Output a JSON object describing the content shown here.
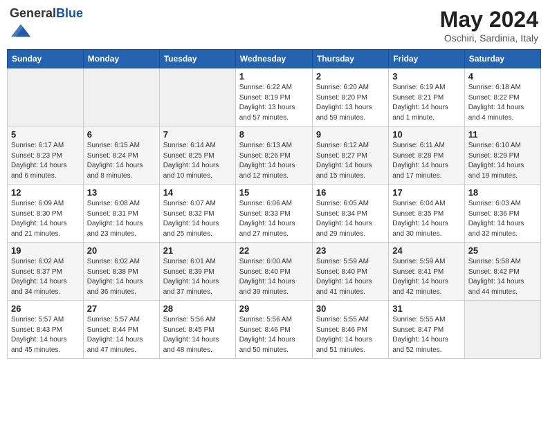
{
  "header": {
    "logo_general": "General",
    "logo_blue": "Blue",
    "month_title": "May 2024",
    "subtitle": "Oschiri, Sardinia, Italy"
  },
  "days_of_week": [
    "Sunday",
    "Monday",
    "Tuesday",
    "Wednesday",
    "Thursday",
    "Friday",
    "Saturday"
  ],
  "weeks": [
    [
      {
        "num": "",
        "info": ""
      },
      {
        "num": "",
        "info": ""
      },
      {
        "num": "",
        "info": ""
      },
      {
        "num": "1",
        "info": "Sunrise: 6:22 AM\nSunset: 8:19 PM\nDaylight: 13 hours\nand 57 minutes."
      },
      {
        "num": "2",
        "info": "Sunrise: 6:20 AM\nSunset: 8:20 PM\nDaylight: 13 hours\nand 59 minutes."
      },
      {
        "num": "3",
        "info": "Sunrise: 6:19 AM\nSunset: 8:21 PM\nDaylight: 14 hours\nand 1 minute."
      },
      {
        "num": "4",
        "info": "Sunrise: 6:18 AM\nSunset: 8:22 PM\nDaylight: 14 hours\nand 4 minutes."
      }
    ],
    [
      {
        "num": "5",
        "info": "Sunrise: 6:17 AM\nSunset: 8:23 PM\nDaylight: 14 hours\nand 6 minutes."
      },
      {
        "num": "6",
        "info": "Sunrise: 6:15 AM\nSunset: 8:24 PM\nDaylight: 14 hours\nand 8 minutes."
      },
      {
        "num": "7",
        "info": "Sunrise: 6:14 AM\nSunset: 8:25 PM\nDaylight: 14 hours\nand 10 minutes."
      },
      {
        "num": "8",
        "info": "Sunrise: 6:13 AM\nSunset: 8:26 PM\nDaylight: 14 hours\nand 12 minutes."
      },
      {
        "num": "9",
        "info": "Sunrise: 6:12 AM\nSunset: 8:27 PM\nDaylight: 14 hours\nand 15 minutes."
      },
      {
        "num": "10",
        "info": "Sunrise: 6:11 AM\nSunset: 8:28 PM\nDaylight: 14 hours\nand 17 minutes."
      },
      {
        "num": "11",
        "info": "Sunrise: 6:10 AM\nSunset: 8:29 PM\nDaylight: 14 hours\nand 19 minutes."
      }
    ],
    [
      {
        "num": "12",
        "info": "Sunrise: 6:09 AM\nSunset: 8:30 PM\nDaylight: 14 hours\nand 21 minutes."
      },
      {
        "num": "13",
        "info": "Sunrise: 6:08 AM\nSunset: 8:31 PM\nDaylight: 14 hours\nand 23 minutes."
      },
      {
        "num": "14",
        "info": "Sunrise: 6:07 AM\nSunset: 8:32 PM\nDaylight: 14 hours\nand 25 minutes."
      },
      {
        "num": "15",
        "info": "Sunrise: 6:06 AM\nSunset: 8:33 PM\nDaylight: 14 hours\nand 27 minutes."
      },
      {
        "num": "16",
        "info": "Sunrise: 6:05 AM\nSunset: 8:34 PM\nDaylight: 14 hours\nand 29 minutes."
      },
      {
        "num": "17",
        "info": "Sunrise: 6:04 AM\nSunset: 8:35 PM\nDaylight: 14 hours\nand 30 minutes."
      },
      {
        "num": "18",
        "info": "Sunrise: 6:03 AM\nSunset: 8:36 PM\nDaylight: 14 hours\nand 32 minutes."
      }
    ],
    [
      {
        "num": "19",
        "info": "Sunrise: 6:02 AM\nSunset: 8:37 PM\nDaylight: 14 hours\nand 34 minutes."
      },
      {
        "num": "20",
        "info": "Sunrise: 6:02 AM\nSunset: 8:38 PM\nDaylight: 14 hours\nand 36 minutes."
      },
      {
        "num": "21",
        "info": "Sunrise: 6:01 AM\nSunset: 8:39 PM\nDaylight: 14 hours\nand 37 minutes."
      },
      {
        "num": "22",
        "info": "Sunrise: 6:00 AM\nSunset: 8:40 PM\nDaylight: 14 hours\nand 39 minutes."
      },
      {
        "num": "23",
        "info": "Sunrise: 5:59 AM\nSunset: 8:40 PM\nDaylight: 14 hours\nand 41 minutes."
      },
      {
        "num": "24",
        "info": "Sunrise: 5:59 AM\nSunset: 8:41 PM\nDaylight: 14 hours\nand 42 minutes."
      },
      {
        "num": "25",
        "info": "Sunrise: 5:58 AM\nSunset: 8:42 PM\nDaylight: 14 hours\nand 44 minutes."
      }
    ],
    [
      {
        "num": "26",
        "info": "Sunrise: 5:57 AM\nSunset: 8:43 PM\nDaylight: 14 hours\nand 45 minutes."
      },
      {
        "num": "27",
        "info": "Sunrise: 5:57 AM\nSunset: 8:44 PM\nDaylight: 14 hours\nand 47 minutes."
      },
      {
        "num": "28",
        "info": "Sunrise: 5:56 AM\nSunset: 8:45 PM\nDaylight: 14 hours\nand 48 minutes."
      },
      {
        "num": "29",
        "info": "Sunrise: 5:56 AM\nSunset: 8:46 PM\nDaylight: 14 hours\nand 50 minutes."
      },
      {
        "num": "30",
        "info": "Sunrise: 5:55 AM\nSunset: 8:46 PM\nDaylight: 14 hours\nand 51 minutes."
      },
      {
        "num": "31",
        "info": "Sunrise: 5:55 AM\nSunset: 8:47 PM\nDaylight: 14 hours\nand 52 minutes."
      },
      {
        "num": "",
        "info": ""
      }
    ]
  ]
}
